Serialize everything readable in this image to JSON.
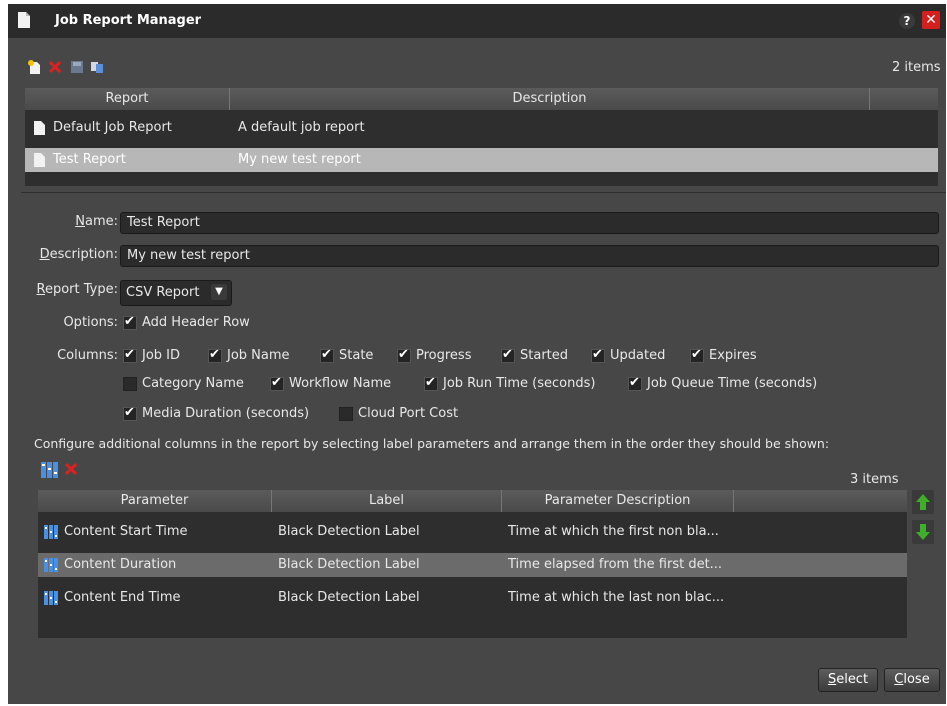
{
  "window": {
    "title": "Job Report Manager",
    "help_label": "?",
    "close_label": "✕"
  },
  "toolbar": {
    "icons": [
      "new-report-icon",
      "delete-icon",
      "save-icon",
      "copy-icon"
    ],
    "count": "2 items"
  },
  "reports": {
    "columns": [
      "Report",
      "Description"
    ],
    "rows": [
      {
        "name": "Default Job Report",
        "description": "A default job report",
        "selected": false
      },
      {
        "name": "Test Report",
        "description": "My new test report",
        "selected": true
      }
    ]
  },
  "form": {
    "name_label_u": "N",
    "name_label_rest": "ame:",
    "name_value": "Test Report",
    "desc_label_u": "D",
    "desc_label_rest": "escription:",
    "desc_value": "My new test report",
    "type_label_u": "R",
    "type_label_rest": "eport Type:",
    "type_value": "CSV Report",
    "options_label": "Options:",
    "option_header": "Add Header Row",
    "columns_label": "Columns:",
    "columns": [
      {
        "label": "Job ID",
        "checked": true
      },
      {
        "label": "Job Name",
        "checked": true
      },
      {
        "label": "State",
        "checked": true
      },
      {
        "label": "Progress",
        "checked": true
      },
      {
        "label": "Started",
        "checked": true
      },
      {
        "label": "Updated",
        "checked": true
      },
      {
        "label": "Expires",
        "checked": true
      },
      {
        "label": "Category Name",
        "checked": false
      },
      {
        "label": "Workflow Name",
        "checked": true
      },
      {
        "label": "Job Run Time (seconds)",
        "checked": true
      },
      {
        "label": "Job Queue Time (seconds)",
        "checked": true
      },
      {
        "label": "Media Duration (seconds)",
        "checked": true
      },
      {
        "label": "Cloud Port Cost",
        "checked": false
      }
    ]
  },
  "params": {
    "instructions": "Configure additional columns in the report by selecting label parameters and arrange them in the order they should be shown:",
    "count": "3 items",
    "columns": [
      "Parameter",
      "Label",
      "Parameter Description"
    ],
    "rows": [
      {
        "parameter": "Content Start Time",
        "label": "Black Detection Label",
        "description": "Time at which the first non bla...",
        "selected": false
      },
      {
        "parameter": "Content Duration",
        "label": "Black Detection Label",
        "description": "Time elapsed from the first det...",
        "selected": true
      },
      {
        "parameter": "Content End Time",
        "label": "Black Detection Label",
        "description": "Time at which the last non blac...",
        "selected": false
      }
    ]
  },
  "buttons": {
    "select_u": "S",
    "select_rest": "elect",
    "close_u": "C",
    "close_rest": "lose"
  },
  "colors": {
    "background": "#474747",
    "titlebar": "#2b2b2b",
    "selected_row": "#b7b7b7",
    "close_red": "#d41f1f",
    "arrow_green": "#3fae2a"
  }
}
